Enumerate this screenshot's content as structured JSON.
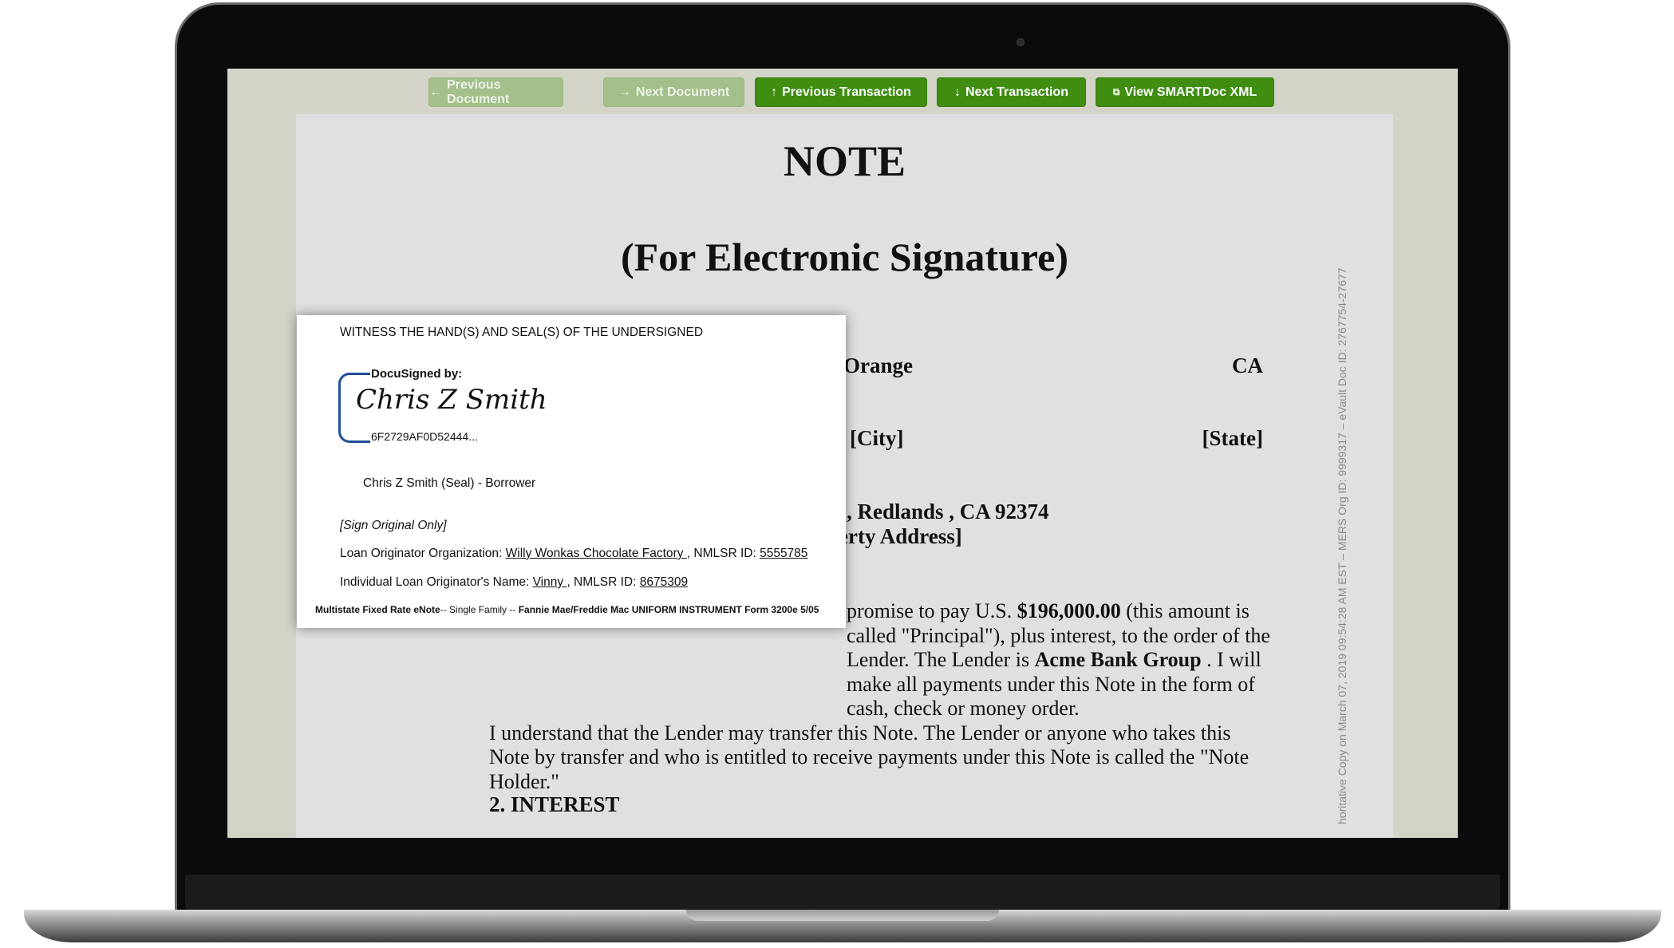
{
  "toolbar": {
    "buttons": [
      {
        "label": "Previous Document",
        "icon": "arrow-left-icon",
        "glyph": "←",
        "enabled": false
      },
      {
        "label": "Next Document",
        "icon": "arrow-right-icon",
        "glyph": "→",
        "enabled": false
      },
      {
        "label": "Previous Transaction",
        "icon": "arrow-up-icon",
        "glyph": "↑",
        "enabled": true
      },
      {
        "label": "Next Transaction",
        "icon": "arrow-down-icon",
        "glyph": "↓",
        "enabled": true
      },
      {
        "label": "View SMARTDoc XML",
        "icon": "external-window-icon",
        "glyph": "⧉",
        "enabled": true
      }
    ]
  },
  "document": {
    "title": "NOTE",
    "subtitle": "(For Electronic Signature)",
    "county": "Orange",
    "state": "CA",
    "city_label": "[City]",
    "state_label": "[State]",
    "address": ", Redlands , CA 92374",
    "address_label": "erty Address]",
    "para1_a": "promise to pay U.S. ",
    "amount": "$196,000.00",
    "para1_b": " (this amount is called \"Principal\"), plus interest, to the order of the Lender. The Lender is ",
    "lender": "Acme Bank Group",
    "para1_c": " . I will make all payments under this Note in the form of cash, check or money order.",
    "para2": "I understand that the Lender may transfer this Note. The Lender or anyone who takes this Note by transfer and who is entitled to receive payments under this Note is called the \"Note Holder.\"",
    "section2": "2. INTEREST",
    "vertical_stamp": "horitative Copy on March 07, 2019 09:54:28 AM EST – MERS Org ID: 9999317 – eVault Doc ID: 2767754-27677"
  },
  "popup": {
    "witness": "WITNESS THE HAND(S) AND SEAL(S) OF THE UNDERSIGNED",
    "docusigned_by": "DocuSigned by:",
    "signature": "Chris Z Smith",
    "signature_id": "6F2729AF0D52444...",
    "borrower": "Chris Z Smith (Seal) - Borrower",
    "sign_original": "[Sign Original Only]",
    "lo_org_label": "Loan Originator Organization: ",
    "lo_org": "Willy Wonkas Chocolate Factory ",
    "lo_org_nmlsr_label": ", NMLSR ID: ",
    "lo_org_nmlsr": "5555785",
    "lo_name_label": "Individual Loan Originator's Name: ",
    "lo_name": "Vinny ",
    "lo_name_nmlsr_label": ", NMLSR ID: ",
    "lo_name_nmlsr": "8675309",
    "footer_a": "Multistate Fixed Rate eNote",
    "footer_b": "-- Single Family -- ",
    "footer_c": "Fannie Mae/Freddie Mac UNIFORM INSTRUMENT Form 3200e 5/05"
  },
  "colors": {
    "button_enabled": "#3f8e12",
    "button_disabled": "#a3bf8a",
    "signature_bracket": "#1f4e9a"
  }
}
